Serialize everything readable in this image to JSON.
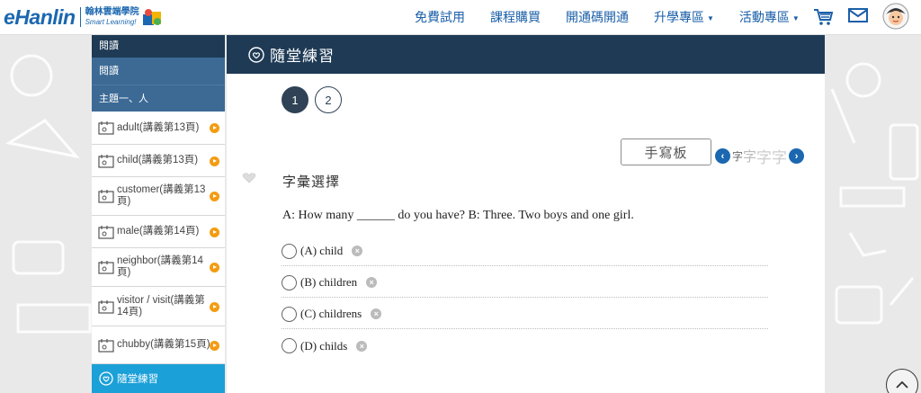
{
  "header": {
    "logo_main": "eHanlin",
    "logo_cn": "翰林雲端學院",
    "logo_en": "Smart Learning!",
    "nav": [
      {
        "label": "免費試用",
        "dropdown": false
      },
      {
        "label": "課程購買",
        "dropdown": false
      },
      {
        "label": "開通碼開通",
        "dropdown": false
      },
      {
        "label": "升學專區",
        "dropdown": true
      },
      {
        "label": "活動專區",
        "dropdown": true
      }
    ],
    "icons": [
      "cart-icon",
      "mail-icon",
      "avatar"
    ]
  },
  "sidebar": {
    "header": "閱讀",
    "subheader": "閱讀",
    "topic": "主題一、人",
    "items": [
      {
        "label": "adult(講義第13頁)"
      },
      {
        "label": "child(講義第13頁)"
      },
      {
        "label": "customer(講義第13頁)"
      },
      {
        "label": "male(講義第14頁)"
      },
      {
        "label": "neighbor(講義第14頁)"
      },
      {
        "label": "visitor / visit(講義第14頁)"
      },
      {
        "label": "chubby(講義第15頁)"
      }
    ],
    "active_label": "隨堂練習"
  },
  "main": {
    "title": "隨堂練習",
    "steps": [
      "1",
      "2"
    ],
    "current_step": "1",
    "handwriting_button": "手寫板",
    "font_size_chars": [
      "字",
      "字",
      "字",
      "字"
    ],
    "section_title": "字彙選擇",
    "question": "A: How many ______ do you have?  B: Three.  Two boys and one girl.",
    "options": [
      {
        "label": "(A) child"
      },
      {
        "label": "(B) children"
      },
      {
        "label": "(C) childrens"
      },
      {
        "label": "(D) childs"
      }
    ]
  },
  "colors": {
    "brand_blue": "#1b67b0",
    "dark_navy": "#1e3a55",
    "sidebar_mid": "#3c6a95",
    "active_cyan": "#1ba0d8",
    "orange": "#f39c12"
  }
}
